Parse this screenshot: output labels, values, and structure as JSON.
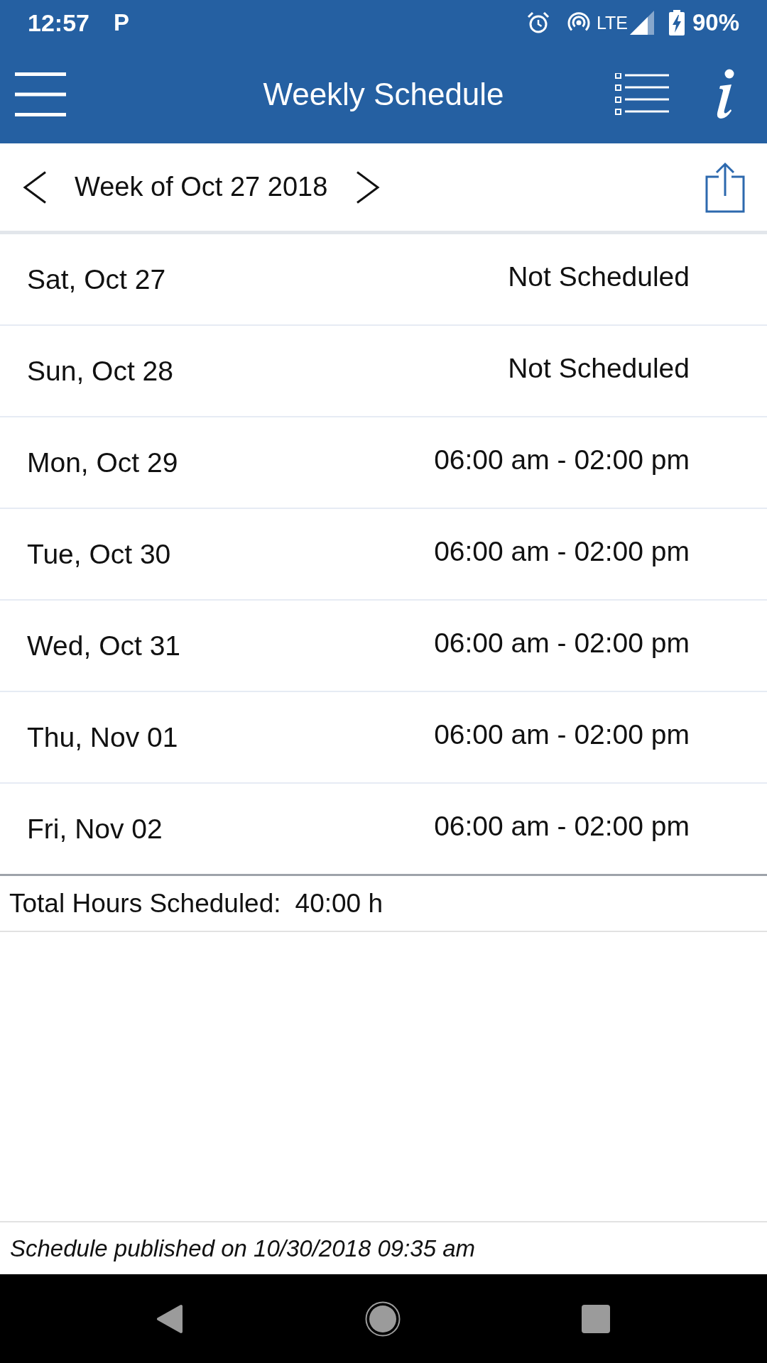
{
  "status_bar": {
    "time": "12:57",
    "notification": "P",
    "network": "LTE",
    "battery": "90%"
  },
  "toolbar": {
    "title": "Weekly Schedule"
  },
  "week_nav": {
    "label": "Week of Oct 27 2018"
  },
  "days": [
    {
      "date": "Sat, Oct 27",
      "shift": "Not Scheduled"
    },
    {
      "date": "Sun, Oct 28",
      "shift": "Not Scheduled"
    },
    {
      "date": "Mon, Oct 29",
      "shift": "06:00 am - 02:00 pm"
    },
    {
      "date": "Tue, Oct 30",
      "shift": "06:00 am - 02:00 pm"
    },
    {
      "date": "Wed, Oct 31",
      "shift": "06:00 am - 02:00 pm"
    },
    {
      "date": "Thu, Nov 01",
      "shift": "06:00 am - 02:00 pm"
    },
    {
      "date": "Fri, Nov 02",
      "shift": "06:00 am - 02:00 pm"
    }
  ],
  "total": {
    "label": "Total Hours Scheduled:",
    "value": "40:00 h"
  },
  "footer": {
    "published": "Schedule published on 10/30/2018 09:35 am"
  }
}
